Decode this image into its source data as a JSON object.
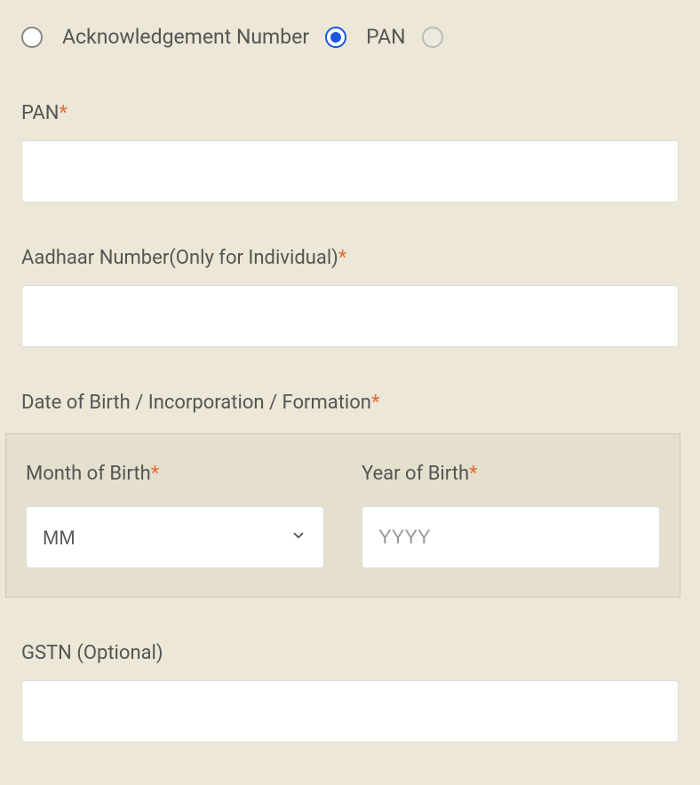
{
  "radios": {
    "ack": {
      "label": "Acknowledgement Number",
      "selected": false,
      "disabled": false
    },
    "pan": {
      "label": "PAN",
      "selected": true,
      "disabled": false
    },
    "third": {
      "label": "",
      "selected": false,
      "disabled": true
    }
  },
  "fields": {
    "pan": {
      "label": "PAN",
      "required": "*",
      "value": ""
    },
    "aadhaar": {
      "label": "Aadhaar Number(Only for Individual)",
      "required": "*",
      "value": ""
    },
    "dob_section": {
      "label": "Date of Birth / Incorporation / Formation",
      "required": "*"
    },
    "month": {
      "label": "Month of Birth",
      "required": "*",
      "placeholder": "MM",
      "value": "MM"
    },
    "year": {
      "label": "Year of Birth",
      "required": "*",
      "placeholder": "YYYY",
      "value": ""
    },
    "gstn": {
      "label": "GSTN (Optional)",
      "value": ""
    }
  }
}
